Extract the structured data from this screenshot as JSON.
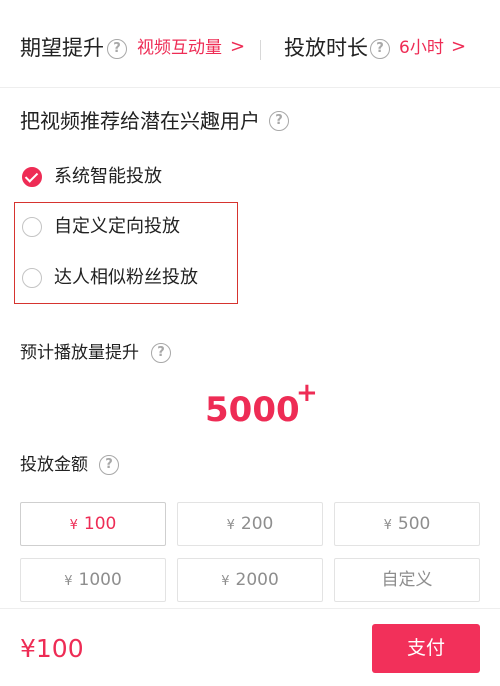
{
  "header": {
    "expect_label": "期望提升",
    "expect_value": "视频互动量",
    "duration_label": "投放时长",
    "duration_value": "6小时",
    "help_glyph": "?",
    "chevron": ">"
  },
  "targeting": {
    "title": "把视频推荐给潜在兴趣用户",
    "options": [
      {
        "label": "系统智能投放",
        "checked": true
      },
      {
        "label": "自定义定向投放",
        "checked": false
      },
      {
        "label": "达人相似粉丝投放",
        "checked": false
      }
    ]
  },
  "estimate": {
    "label": "预计播放量提升",
    "value": "5000",
    "suffix": "+"
  },
  "amount": {
    "label": "投放金额",
    "currency_symbol": "¥",
    "options": [
      {
        "value": "100",
        "selected": true
      },
      {
        "value": "200",
        "selected": false
      },
      {
        "value": "500",
        "selected": false
      },
      {
        "value": "1000",
        "selected": false
      },
      {
        "value": "2000",
        "selected": false
      },
      {
        "value": "自定义",
        "selected": false
      }
    ]
  },
  "footer": {
    "total": "¥100",
    "pay_label": "支付"
  },
  "colors": {
    "accent": "#ee2c55",
    "highlight_border": "#d6342f"
  }
}
